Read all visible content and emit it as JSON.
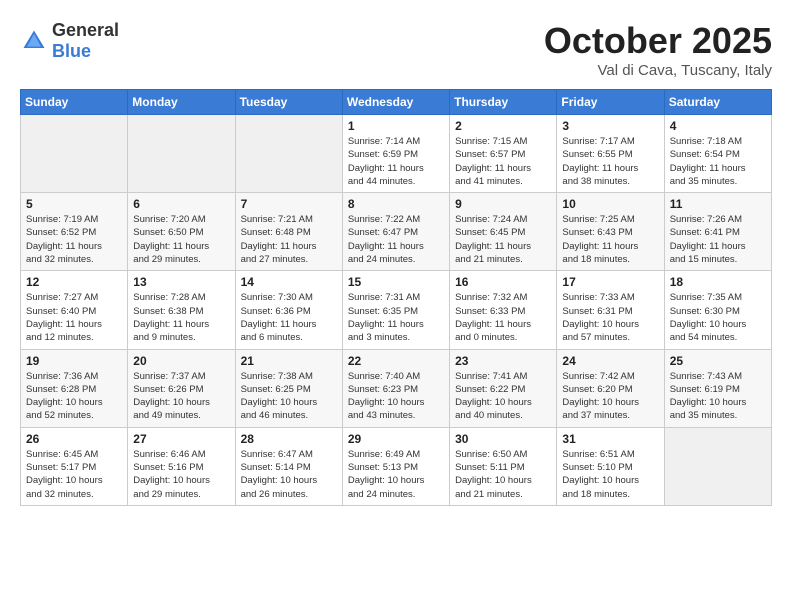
{
  "header": {
    "logo_general": "General",
    "logo_blue": "Blue",
    "month": "October 2025",
    "location": "Val di Cava, Tuscany, Italy"
  },
  "days_of_week": [
    "Sunday",
    "Monday",
    "Tuesday",
    "Wednesday",
    "Thursday",
    "Friday",
    "Saturday"
  ],
  "weeks": [
    [
      {
        "day": "",
        "info": ""
      },
      {
        "day": "",
        "info": ""
      },
      {
        "day": "",
        "info": ""
      },
      {
        "day": "1",
        "info": "Sunrise: 7:14 AM\nSunset: 6:59 PM\nDaylight: 11 hours\nand 44 minutes."
      },
      {
        "day": "2",
        "info": "Sunrise: 7:15 AM\nSunset: 6:57 PM\nDaylight: 11 hours\nand 41 minutes."
      },
      {
        "day": "3",
        "info": "Sunrise: 7:17 AM\nSunset: 6:55 PM\nDaylight: 11 hours\nand 38 minutes."
      },
      {
        "day": "4",
        "info": "Sunrise: 7:18 AM\nSunset: 6:54 PM\nDaylight: 11 hours\nand 35 minutes."
      }
    ],
    [
      {
        "day": "5",
        "info": "Sunrise: 7:19 AM\nSunset: 6:52 PM\nDaylight: 11 hours\nand 32 minutes."
      },
      {
        "day": "6",
        "info": "Sunrise: 7:20 AM\nSunset: 6:50 PM\nDaylight: 11 hours\nand 29 minutes."
      },
      {
        "day": "7",
        "info": "Sunrise: 7:21 AM\nSunset: 6:48 PM\nDaylight: 11 hours\nand 27 minutes."
      },
      {
        "day": "8",
        "info": "Sunrise: 7:22 AM\nSunset: 6:47 PM\nDaylight: 11 hours\nand 24 minutes."
      },
      {
        "day": "9",
        "info": "Sunrise: 7:24 AM\nSunset: 6:45 PM\nDaylight: 11 hours\nand 21 minutes."
      },
      {
        "day": "10",
        "info": "Sunrise: 7:25 AM\nSunset: 6:43 PM\nDaylight: 11 hours\nand 18 minutes."
      },
      {
        "day": "11",
        "info": "Sunrise: 7:26 AM\nSunset: 6:41 PM\nDaylight: 11 hours\nand 15 minutes."
      }
    ],
    [
      {
        "day": "12",
        "info": "Sunrise: 7:27 AM\nSunset: 6:40 PM\nDaylight: 11 hours\nand 12 minutes."
      },
      {
        "day": "13",
        "info": "Sunrise: 7:28 AM\nSunset: 6:38 PM\nDaylight: 11 hours\nand 9 minutes."
      },
      {
        "day": "14",
        "info": "Sunrise: 7:30 AM\nSunset: 6:36 PM\nDaylight: 11 hours\nand 6 minutes."
      },
      {
        "day": "15",
        "info": "Sunrise: 7:31 AM\nSunset: 6:35 PM\nDaylight: 11 hours\nand 3 minutes."
      },
      {
        "day": "16",
        "info": "Sunrise: 7:32 AM\nSunset: 6:33 PM\nDaylight: 11 hours\nand 0 minutes."
      },
      {
        "day": "17",
        "info": "Sunrise: 7:33 AM\nSunset: 6:31 PM\nDaylight: 10 hours\nand 57 minutes."
      },
      {
        "day": "18",
        "info": "Sunrise: 7:35 AM\nSunset: 6:30 PM\nDaylight: 10 hours\nand 54 minutes."
      }
    ],
    [
      {
        "day": "19",
        "info": "Sunrise: 7:36 AM\nSunset: 6:28 PM\nDaylight: 10 hours\nand 52 minutes."
      },
      {
        "day": "20",
        "info": "Sunrise: 7:37 AM\nSunset: 6:26 PM\nDaylight: 10 hours\nand 49 minutes."
      },
      {
        "day": "21",
        "info": "Sunrise: 7:38 AM\nSunset: 6:25 PM\nDaylight: 10 hours\nand 46 minutes."
      },
      {
        "day": "22",
        "info": "Sunrise: 7:40 AM\nSunset: 6:23 PM\nDaylight: 10 hours\nand 43 minutes."
      },
      {
        "day": "23",
        "info": "Sunrise: 7:41 AM\nSunset: 6:22 PM\nDaylight: 10 hours\nand 40 minutes."
      },
      {
        "day": "24",
        "info": "Sunrise: 7:42 AM\nSunset: 6:20 PM\nDaylight: 10 hours\nand 37 minutes."
      },
      {
        "day": "25",
        "info": "Sunrise: 7:43 AM\nSunset: 6:19 PM\nDaylight: 10 hours\nand 35 minutes."
      }
    ],
    [
      {
        "day": "26",
        "info": "Sunrise: 6:45 AM\nSunset: 5:17 PM\nDaylight: 10 hours\nand 32 minutes."
      },
      {
        "day": "27",
        "info": "Sunrise: 6:46 AM\nSunset: 5:16 PM\nDaylight: 10 hours\nand 29 minutes."
      },
      {
        "day": "28",
        "info": "Sunrise: 6:47 AM\nSunset: 5:14 PM\nDaylight: 10 hours\nand 26 minutes."
      },
      {
        "day": "29",
        "info": "Sunrise: 6:49 AM\nSunset: 5:13 PM\nDaylight: 10 hours\nand 24 minutes."
      },
      {
        "day": "30",
        "info": "Sunrise: 6:50 AM\nSunset: 5:11 PM\nDaylight: 10 hours\nand 21 minutes."
      },
      {
        "day": "31",
        "info": "Sunrise: 6:51 AM\nSunset: 5:10 PM\nDaylight: 10 hours\nand 18 minutes."
      },
      {
        "day": "",
        "info": ""
      }
    ]
  ]
}
